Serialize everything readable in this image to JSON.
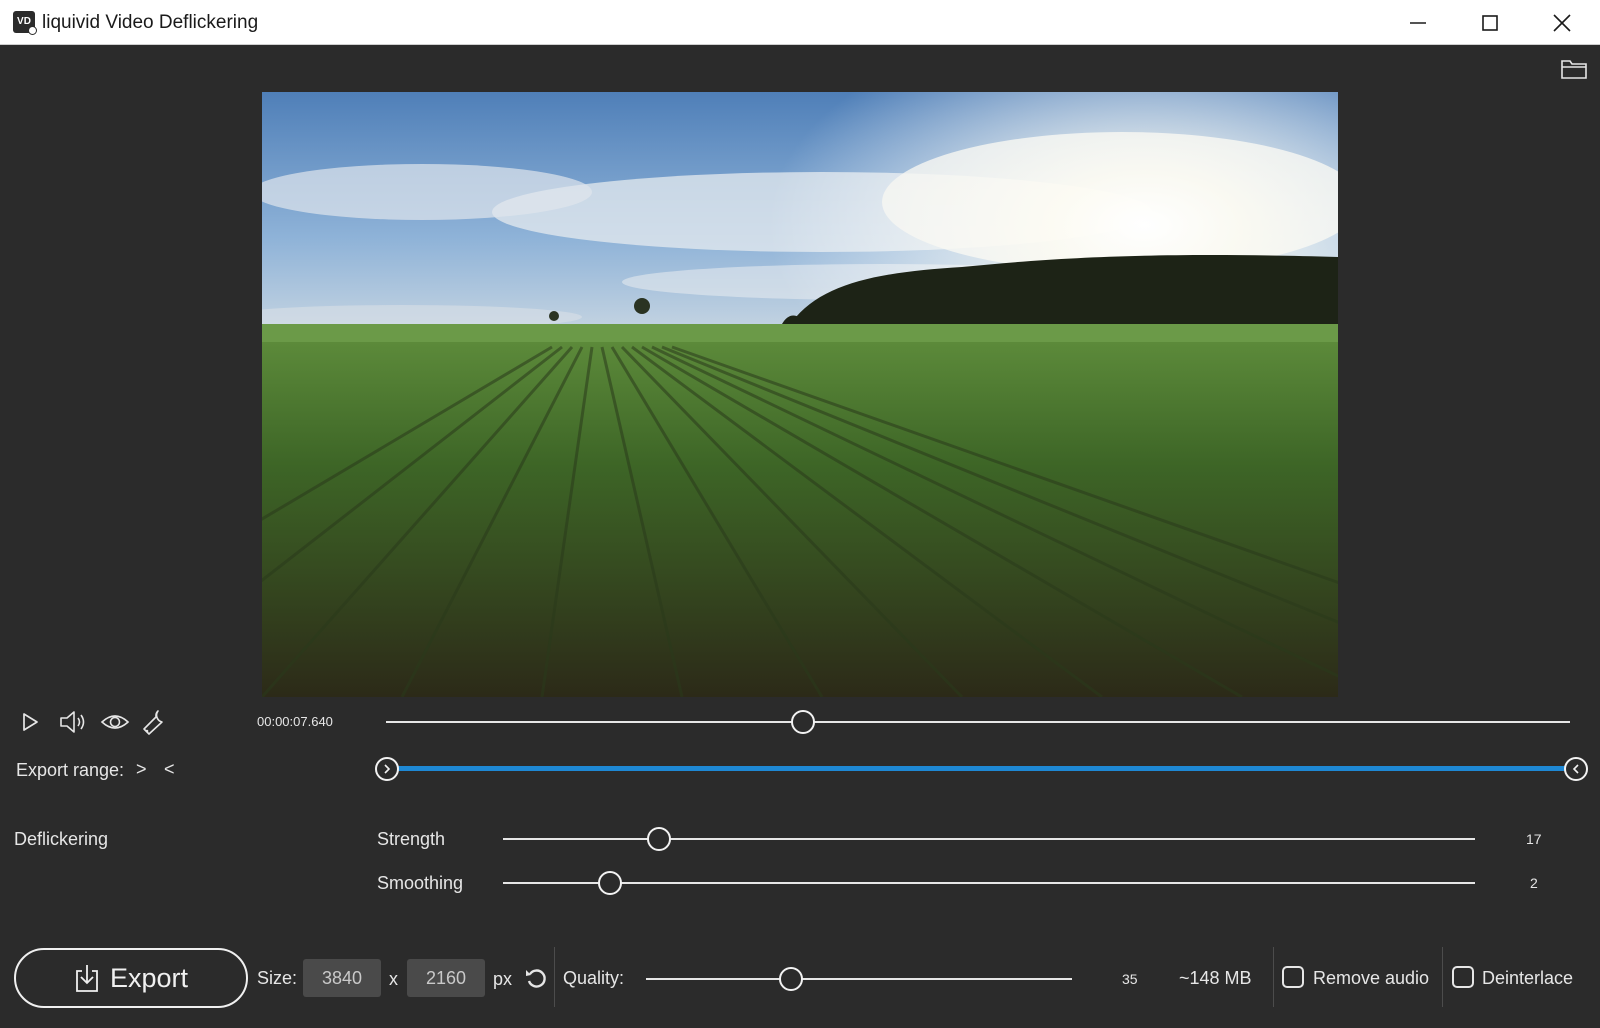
{
  "window": {
    "icon_text": "VD",
    "title": "liquivid Video Deflickering"
  },
  "player": {
    "timecode": "00:00:07.640",
    "position_fraction": 0.352,
    "export_range_label": "Export range:",
    "export_range_start_glyph": ">",
    "export_range_end_glyph": "<",
    "export_range": [
      0.0,
      1.0
    ]
  },
  "deflickering": {
    "section_label": "Deflickering",
    "strength": {
      "label": "Strength",
      "value": "17",
      "fraction": 0.16
    },
    "smoothing": {
      "label": "Smoothing",
      "value": "2",
      "fraction": 0.11
    }
  },
  "export": {
    "button_label": "Export",
    "size_label": "Size:",
    "width": "3840",
    "x_label": "x",
    "height": "2160",
    "unit": "px",
    "quality_label": "Quality:",
    "quality_value": "35",
    "quality_fraction": 0.34,
    "file_size": "~148 MB",
    "remove_audio_label": "Remove audio",
    "deinterlace_label": "Deinterlace"
  },
  "colors": {
    "background": "#2b2b2b",
    "accent": "#1e88d4",
    "text": "#e6e6e6"
  }
}
